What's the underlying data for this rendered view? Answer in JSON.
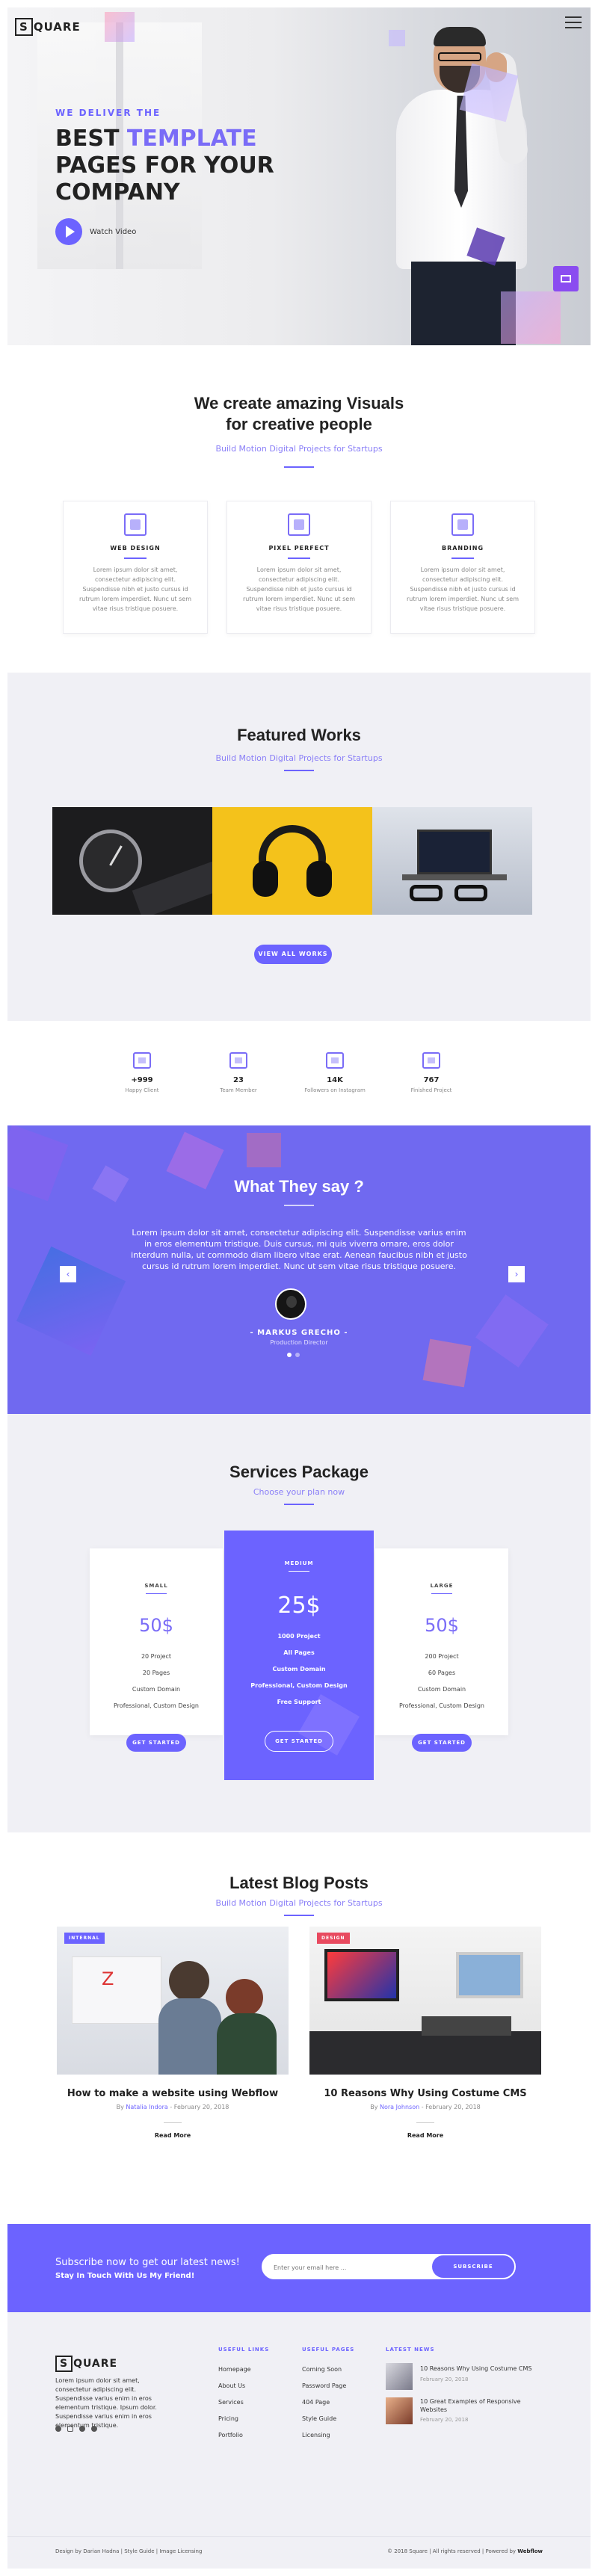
{
  "header": {
    "logo": "SQUARE",
    "logo_box": "S"
  },
  "hero": {
    "pre": "WE DELIVER THE",
    "title_line1_pre": "BEST ",
    "title_line1_accent": "TEMPLATE",
    "title_line2": "PAGES FOR YOUR",
    "title_line3": "COMPANY",
    "video_label": "Watch Video"
  },
  "visuals": {
    "title_line1": "We create amazing Visuals",
    "title_line2": "for creative people",
    "subtitle": "Build Motion Digital Projects for Startups",
    "features": [
      {
        "name": "WEB DESIGN",
        "icon": "web-design-icon",
        "text": "Lorem ipsum dolor sit amet, consectetur adipiscing elit. Suspendisse nibh et justo cursus id rutrum lorem imperdiet. Nunc ut sem vitae risus tristique posuere."
      },
      {
        "name": "PIXEL PERFECT",
        "icon": "pixel-perfect-icon",
        "text": "Lorem ipsum dolor sit amet, consectetur adipiscing elit. Suspendisse nibh et justo cursus id rutrum lorem imperdiet. Nunc ut sem vitae risus tristique posuere."
      },
      {
        "name": "BRANDING",
        "icon": "branding-icon",
        "text": "Lorem ipsum dolor sit amet, consectetur adipiscing elit. Suspendisse nibh et justo cursus id rutrum lorem imperdiet. Nunc ut sem vitae risus tristique posuere."
      }
    ]
  },
  "works": {
    "title": "Featured Works",
    "subtitle": "Build Motion Digital Projects for Startups",
    "button": "VIEW ALL WORKS"
  },
  "stats": [
    {
      "num": "+999",
      "label": "Happy Client"
    },
    {
      "num": "23",
      "label": "Team Member"
    },
    {
      "num": "14K",
      "label": "Followers on Instagram"
    },
    {
      "num": "767",
      "label": "Finished Project"
    }
  ],
  "testimonial": {
    "title": "What They say ?",
    "quote": "Lorem ipsum dolor sit amet, consectetur adipiscing elit. Suspendisse varius enim in eros elementum tristique. Duis cursus, mi quis viverra ornare, eros dolor interdum nulla, ut commodo diam libero vitae erat. Aenean faucibus nibh et justo cursus id rutrum lorem imperdiet. Nunc ut sem vitae risus tristique posuere.",
    "name": "- MARKUS GRECHO -",
    "role": "Production Director",
    "prev": "‹",
    "next": "›"
  },
  "pricing": {
    "title": "Services Package",
    "subtitle": "Choose your plan now",
    "plans": [
      {
        "name": "SMALL",
        "price": "50$",
        "features": [
          "20 Project",
          "20 Pages",
          "Custom Domain",
          "Professional, Custom Design"
        ],
        "button": "GET STARTED"
      },
      {
        "name": "MEDIUM",
        "price": "25$",
        "features": [
          "1000 Project",
          "All Pages",
          "Custom Domain",
          "Professional, Custom Design",
          "Free Support"
        ],
        "button": "GET STARTED"
      },
      {
        "name": "LARGE",
        "price": "50$",
        "features": [
          "200 Project",
          "60 Pages",
          "Custom Domain",
          "Professional, Custom Design"
        ],
        "button": "GET STARTED"
      }
    ]
  },
  "blog": {
    "title": "Latest Blog Posts",
    "subtitle": "Build Motion Digital Projects for Startups",
    "posts": [
      {
        "tag": "INTERNAL",
        "title": "How to make a website using Webflow",
        "by": "By",
        "author": "Natalia Indora",
        "date": "- February 20, 2018",
        "read": "Read More"
      },
      {
        "tag": "DESIGN",
        "title": "10 Reasons Why Using Costume CMS",
        "by": "By",
        "author": "Nora Johnson",
        "date": "- February 20, 2018",
        "read": "Read More"
      }
    ]
  },
  "subscribe": {
    "line1": "Subscribe now to get our latest news!",
    "line2": "Stay In Touch With Us My Friend!",
    "placeholder": "Enter your email here ...",
    "button": "SUBSCRIBE"
  },
  "footer": {
    "about": "Lorem ipsum dolor sit amet, consectetur adipiscing elit. Suspendisse varius enim in eros elementum tristique. Ipsum dolor. Suspendisse varius enim in eros elementum tristique.",
    "useful_links_title": "USEFUL LINKS",
    "useful_links": [
      "Homepage",
      "About Us",
      "Services",
      "Pricing",
      "Portfolio"
    ],
    "useful_pages_title": "USEFUL PAGES",
    "useful_pages": [
      "Coming Soon",
      "Password Page",
      "404 Page",
      "Style Guide",
      "Licensing"
    ],
    "news_title": "LATEST NEWS",
    "news": [
      {
        "title": "10 Reasons Why Using Costume CMS",
        "date": "February 20, 2018"
      },
      {
        "title": "10 Great Examples of Responsive Websites",
        "date": "February 20, 2018"
      }
    ],
    "bottom_left": "Design by Darian Hadna | Style Guide | Image Licensing",
    "bottom_right_pre": "© 2018 Square | All rights reserved | Powered by ",
    "bottom_right_brand": "Webflow"
  },
  "colors": {
    "accent": "#6c63ff",
    "testimonial_bg": "#7069f0",
    "section_bg": "#f0f0f5"
  }
}
